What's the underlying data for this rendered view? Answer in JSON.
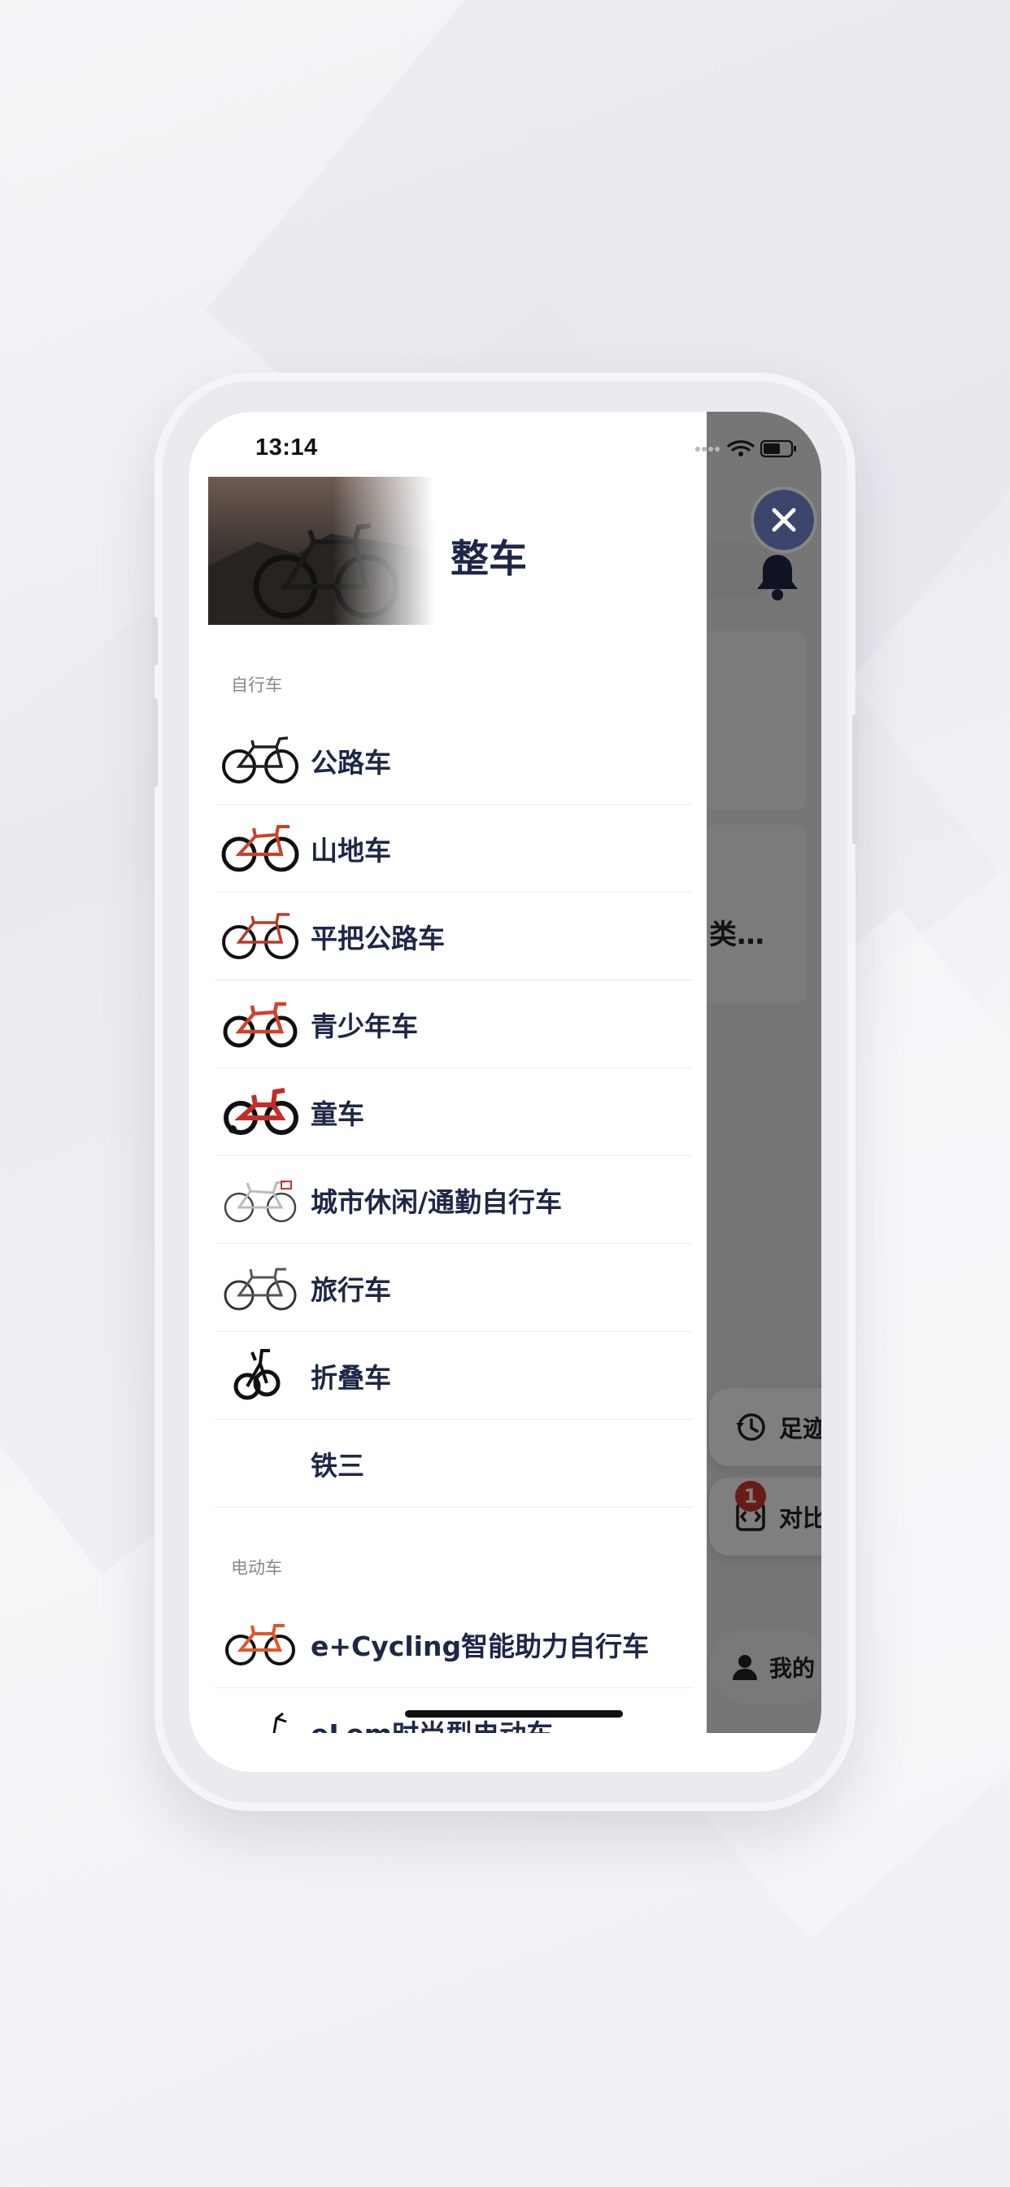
{
  "status": {
    "time": "13:14"
  },
  "drawer": {
    "title": "整车",
    "sections": [
      {
        "title": "自行车",
        "items": [
          {
            "label": "公路车",
            "icon": "road-bike-icon"
          },
          {
            "label": "山地车",
            "icon": "mountain-bike-icon"
          },
          {
            "label": "平把公路车",
            "icon": "flat-bar-road-bike-icon"
          },
          {
            "label": "青少年车",
            "icon": "youth-bike-icon"
          },
          {
            "label": "童车",
            "icon": "kids-bike-icon"
          },
          {
            "label": "城市休闲/通勤自行车",
            "icon": "city-bike-icon"
          },
          {
            "label": "旅行车",
            "icon": "touring-bike-icon"
          },
          {
            "label": "折叠车",
            "icon": "folding-bike-icon"
          },
          {
            "label": "铁三",
            "icon": ""
          }
        ]
      },
      {
        "title": "电动车",
        "items": [
          {
            "label": "e+Cycling智能助力自行车",
            "icon": "e-bike-icon"
          },
          {
            "label": "eLem时尚型电动车",
            "icon": "e-scooter-icon"
          }
        ]
      }
    ]
  },
  "background": {
    "truncated_text": "类…",
    "history_label": "足迹",
    "compare_label": "对比",
    "compare_badge": "1",
    "me_label": "我的"
  },
  "colors": {
    "title": "#1f2748",
    "close_button": "#3c466c",
    "badge": "#d0362f"
  }
}
